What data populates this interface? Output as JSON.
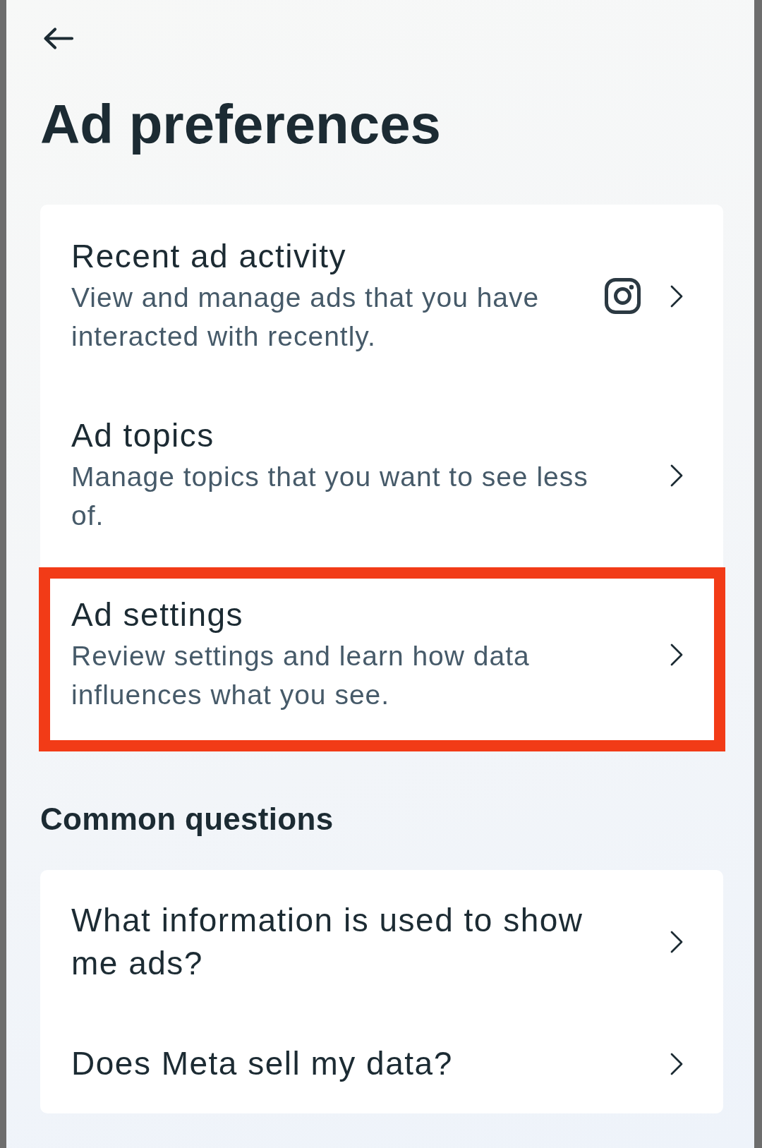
{
  "header": {
    "title": "Ad preferences"
  },
  "ad_items": [
    {
      "title": "Recent ad activity",
      "description": "View and manage ads that you have interacted with recently.",
      "has_icon": true,
      "highlighted": false
    },
    {
      "title": "Ad topics",
      "description": "Manage topics that you want to see less of.",
      "has_icon": false,
      "highlighted": false
    },
    {
      "title": "Ad settings",
      "description": "Review settings and learn how data influences what you see.",
      "has_icon": false,
      "highlighted": true
    }
  ],
  "common_questions": {
    "heading": "Common questions",
    "items": [
      {
        "title": "What information is used to show me ads?"
      },
      {
        "title": "Does Meta sell my data?"
      }
    ]
  }
}
